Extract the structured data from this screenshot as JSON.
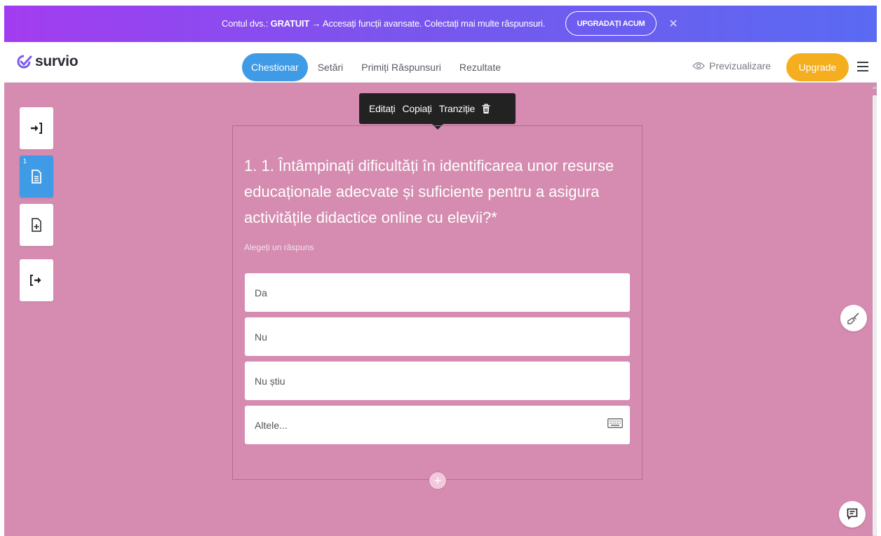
{
  "promo": {
    "prefix": "Contul dvs.: ",
    "plan": "GRATUIT",
    "message": " → Accesați funcții avansate. Colectați mai multe răspunsuri.",
    "button_label": "UPGRADAȚI ACUM",
    "close_glyph": "✕"
  },
  "header": {
    "logo_text": "survio",
    "tabs": [
      {
        "label": "Chestionar",
        "active": true
      },
      {
        "label": "Setări",
        "active": false
      },
      {
        "label": "Primiți Răspunsuri",
        "active": false
      },
      {
        "label": "Rezultate",
        "active": false
      }
    ],
    "preview_label": "Previzualizare",
    "upgrade_label": "Upgrade"
  },
  "sidebar": {
    "items": [
      {
        "name": "intro-page",
        "icon": "sign-in-icon"
      },
      {
        "name": "question-page",
        "icon": "document-icon",
        "number": "1",
        "active": true
      },
      {
        "name": "add-page",
        "icon": "add-document-icon"
      },
      {
        "name": "outro-page",
        "icon": "sign-out-icon"
      }
    ]
  },
  "toolbar": {
    "edit_label": "Editați",
    "copy_label": "Copiați",
    "transition_label": "Tranziție",
    "delete_icon": "trash-icon"
  },
  "question": {
    "title": "1. 1. Întâmpinați dificultăți în identificarea unor resurse educaționale adecvate și suficiente pentru a asigura activitățile didactice online cu elevii?*",
    "subtitle": "Alegeți un răspuns",
    "options": [
      "Da",
      "Nu",
      "Nu știu",
      "Altele..."
    ],
    "other_icon": "keyboard-icon",
    "add_glyph": "+"
  },
  "colors": {
    "background": "#d58cb0",
    "accent": "#3f9be6",
    "upgrade": "#f5ae1e"
  }
}
